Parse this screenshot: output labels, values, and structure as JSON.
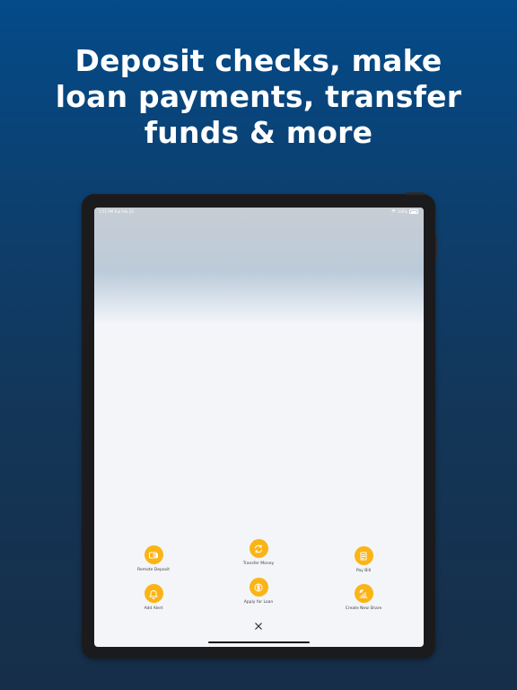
{
  "headline": {
    "line1": "Deposit checks, make",
    "line2": "loan payments, transfer",
    "line3": "funds & more"
  },
  "status_bar": {
    "time": "1:51 PM  Tue Feb 25",
    "battery": "100%"
  },
  "actions": {
    "remote_deposit": {
      "label": "Remote Deposit",
      "icon": "check-deposit-icon"
    },
    "transfer_money": {
      "label": "Transfer Money",
      "icon": "transfer-arrows-icon"
    },
    "pay_bill": {
      "label": "Pay Bill",
      "icon": "bill-icon"
    },
    "add_alert": {
      "label": "Add Alert",
      "icon": "bell-icon"
    },
    "apply_for_loan": {
      "label": "Apply for Loan",
      "icon": "loan-money-icon"
    },
    "create_new_share": {
      "label": "Create New Share",
      "icon": "share-growth-icon"
    }
  },
  "close": {
    "icon": "close-icon"
  },
  "colors": {
    "accent": "#fbb416",
    "background_top": "#034b8a",
    "background_bottom": "#162e48",
    "screen_bg": "#f4f5f9",
    "device_frame": "#1b1b1d"
  }
}
